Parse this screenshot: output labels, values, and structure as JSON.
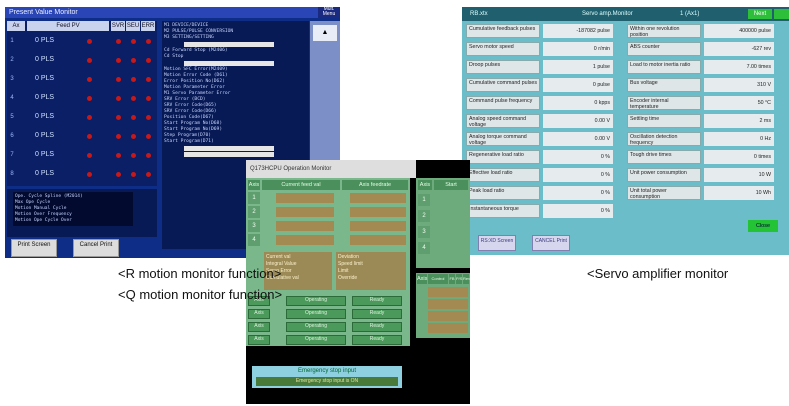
{
  "r_monitor": {
    "title": "Present Value Monitor",
    "title_right": "Mult. Menu",
    "header": {
      "ax": "Ax",
      "feed": "Feed PV",
      "c1": "SVR",
      "c2": "SEU",
      "c3": "ERR"
    },
    "rows": [
      {
        "num": "1",
        "value": "0 PLS"
      },
      {
        "num": "2",
        "value": "0 PLS"
      },
      {
        "num": "3",
        "value": "0 PLS"
      },
      {
        "num": "4",
        "value": "0 PLS"
      },
      {
        "num": "5",
        "value": "0 PLS"
      },
      {
        "num": "6",
        "value": "0 PLS"
      },
      {
        "num": "7",
        "value": "0 PLS"
      },
      {
        "num": "8",
        "value": "0 PLS"
      }
    ],
    "info_lines": [
      "M1 DEVICE/DEVICE",
      "M2 PULSE/PULSE CONVERSION",
      "M3 SETTING/SETTING",
      "Cd Forward Stop (M2406)",
      "Cd Stop",
      "Motion SFC Error(M2409)",
      "Motion Error Code (D61)",
      "Error Position No(D62)",
      "Motion Parameter Error",
      "M1 Servo Parameter Error",
      "SRV Error (BCD)",
      "SRV Error Code(D65)",
      "SRV Error Code(D66)",
      "Position Code(D67)",
      "Start Program No(D68)",
      "Start Program No(D69)",
      "Step Program(D70)",
      "Start Program(D71)"
    ],
    "bottom_lines": [
      "Ope. Cycle Spline (M2014)",
      "Max Ope Cycle",
      "Motion Manual Cycle",
      "Motion Over Frequency",
      "Motion Ope Cycle Over"
    ],
    "buttons": {
      "print_screen": "Print Screen",
      "cancel_print": "Cancel Print"
    },
    "scroll_up": "▲"
  },
  "servo_monitor": {
    "title_left": "RB.xtx",
    "title_mid": "Servo amp.Monitor",
    "title_num": "1 (Ax1)",
    "title_status": "Next",
    "left_rows": [
      {
        "label": "Cumulative feedback pulses",
        "value": "-187082 pulse"
      },
      {
        "label": "Servo motor speed",
        "value": "0 r/min"
      },
      {
        "label": "Droop pulses",
        "value": "1 pulse"
      },
      {
        "label": "Cumulative command pulses",
        "value": "0 pulse"
      },
      {
        "label": "Command pulse frequency",
        "value": "0 kpps"
      },
      {
        "label": "Analog speed command voltage",
        "value": "0.00 V"
      },
      {
        "label": "Analog torque command voltage",
        "value": "0.00 V"
      },
      {
        "label": "Regenerative load ratio",
        "value": "0 %"
      },
      {
        "label": "Effective load ratio",
        "value": "0 %"
      },
      {
        "label": "Peak load ratio",
        "value": "0 %"
      },
      {
        "label": "Instantaneous torque",
        "value": "0 %"
      }
    ],
    "right_rows": [
      {
        "label": "Within one revolution position",
        "value": "400000 pulse"
      },
      {
        "label": "ABS counter",
        "value": "-627 rev"
      },
      {
        "label": "Load to motor inertia ratio",
        "value": "7.00 times"
      },
      {
        "label": "Bus voltage",
        "value": "310 V"
      },
      {
        "label": "Encoder internal temperature",
        "value": "50 °C"
      },
      {
        "label": "Settling time",
        "value": "2 ms"
      },
      {
        "label": "Oscillation detection frequency",
        "value": "0 Hz"
      },
      {
        "label": "Tough drive times",
        "value": "0 times"
      },
      {
        "label": "Unit power consumption",
        "value": "10 W"
      },
      {
        "label": "Unit total power consumption",
        "value": "10 Wh"
      }
    ],
    "buttons": {
      "b1": "RS:XD Screen",
      "b2": "CANCEL Print"
    },
    "close": "Close"
  },
  "q_monitor": {
    "title": "Q173HCPU Operation Monitor",
    "headers": {
      "axis": "Axis",
      "current": "Current feed val",
      "axis_feedrate": "Axis feedrate",
      "axis2": "Axis",
      "start": "Start"
    },
    "rows": [
      "1",
      "2",
      "3",
      "4"
    ],
    "mid_labels": [
      "Current val",
      "Integral Value",
      "Servo Error",
      "Cumulative val"
    ],
    "mid_labels_right": [
      "Deviation",
      "Speed limit",
      "Limit",
      "Override"
    ],
    "side_header": {
      "axis": "Axis",
      "control": "Control system",
      "c1": "FB",
      "c2": "P/S",
      "c3": "Rev."
    },
    "side_rows": [
      "1",
      "2",
      "3",
      "4"
    ],
    "lower_rows": [
      {
        "axis": "Axis",
        "mode": "Operating",
        "state": "Ready"
      },
      {
        "axis": "Axis",
        "mode": "Operating",
        "state": "Ready"
      },
      {
        "axis": "Axis",
        "mode": "Operating",
        "state": "Ready"
      },
      {
        "axis": "Axis",
        "mode": "Operating",
        "state": "Ready"
      }
    ],
    "emergency_label": "Emergency stop input",
    "emergency_value": "Emergency stop input is ON"
  },
  "captions": {
    "r": "<R motion monitor function>",
    "q": "<Q motion monitor function>",
    "servo": "<Servo amplifier monitor"
  }
}
